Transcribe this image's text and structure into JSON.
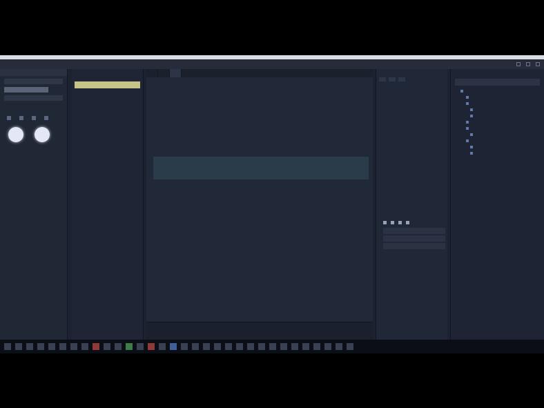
{
  "menubar": {
    "items": [
      "",
      "",
      "",
      "",
      ""
    ]
  },
  "toolbox": {
    "title": ""
  },
  "filetree": {
    "items": [
      "",
      "",
      "",
      "",
      "",
      "",
      "",
      "",
      "",
      "",
      "",
      "",
      "",
      "",
      "",
      "",
      "",
      "",
      "",
      "",
      "",
      "",
      "",
      "",
      "",
      "",
      "",
      "",
      "",
      "",
      "",
      "",
      ""
    ]
  },
  "editor": {
    "tabs": [
      "",
      "",
      ""
    ],
    "breadcrumb": ""
  },
  "props": {
    "title": ""
  },
  "scene": {
    "title": ""
  },
  "taskbar": {
    "clock": ""
  },
  "colors": {
    "background": "#1c2230",
    "selected_file": "#c7c48a",
    "string": "#a2485c",
    "keyword": "#4b8cc9",
    "highlight": "#2a3c4a"
  }
}
